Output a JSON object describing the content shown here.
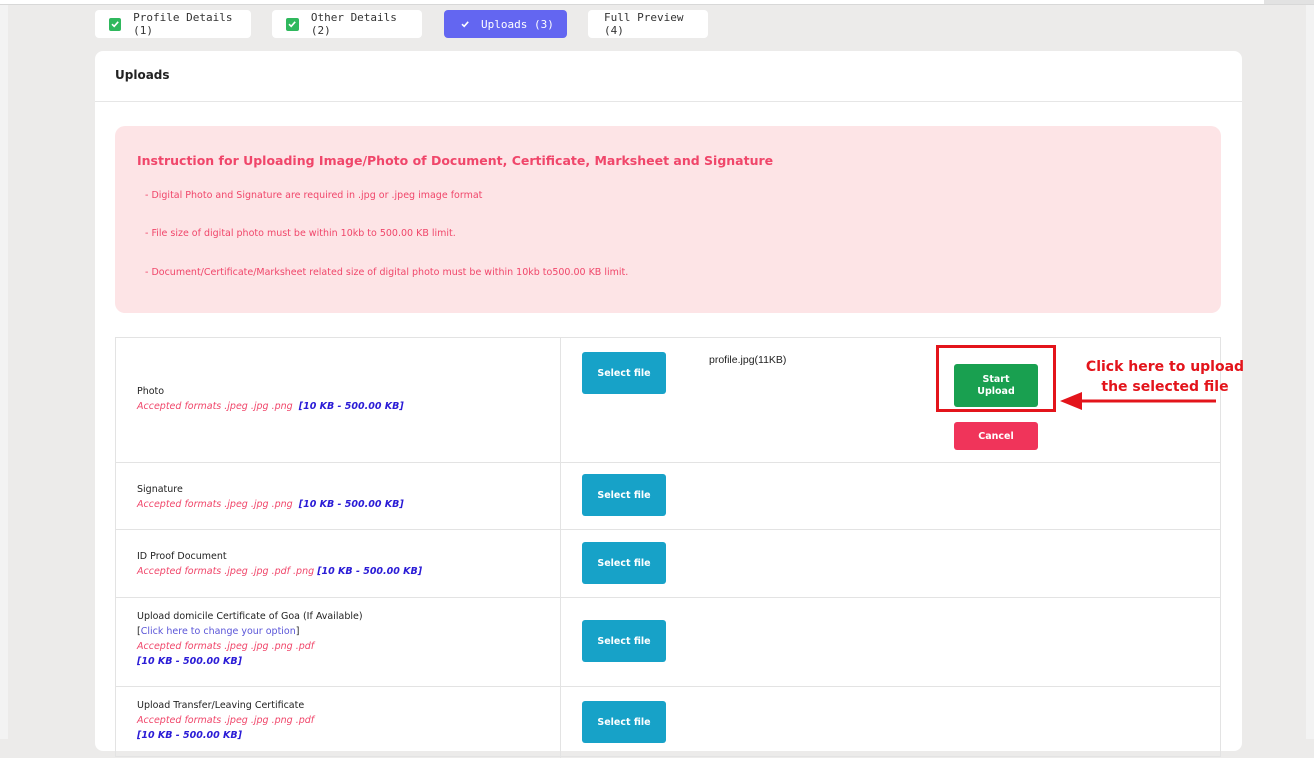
{
  "tabs": [
    {
      "label": "Profile Details (1)",
      "done": true,
      "active": false
    },
    {
      "label": "Other Details (2)",
      "done": true,
      "active": false
    },
    {
      "label": "Uploads (3)",
      "done": true,
      "active": true
    },
    {
      "label": "Full Preview (4)",
      "done": false,
      "active": false
    }
  ],
  "card": {
    "title": "Uploads"
  },
  "instructions": {
    "title": "Instruction for Uploading Image/Photo of Document, Certificate, Marksheet and Signature",
    "lines": [
      "- Digital Photo and Signature are required in .jpg or .jpeg image format",
      "- File size of digital photo must be within 10kb to 500.00 KB limit.",
      "- Document/Certificate/Marksheet related size of digital photo must be within 10kb to500.00 KB limit."
    ]
  },
  "select_label": "Select file",
  "rows": [
    {
      "label": "Photo",
      "formats": "Accepted formats .jpeg .jpg .png",
      "size": "[10 KB - 500.00 KB]",
      "selected_file": "profile.jpg(11KB)",
      "start_label": "Start Upload",
      "cancel_label": "Cancel"
    },
    {
      "label": "Signature",
      "formats": "Accepted formats .jpeg .jpg .png",
      "size": "[10 KB - 500.00 KB]"
    },
    {
      "label": "ID Proof Document",
      "formats": "Accepted formats .jpeg .jpg .pdf .png",
      "size": "[10 KB - 500.00 KB]"
    },
    {
      "label": "Upload domicile Certificate of Goa (If Available)",
      "link_open": "[",
      "link_text": "Click here to change your option",
      "link_close": "]",
      "formats": "Accepted formats .jpeg .jpg .png .pdf",
      "size": "[10 KB - 500.00 KB]"
    },
    {
      "label": "Upload Transfer/Leaving Certificate",
      "formats": "Accepted formats .jpeg .jpg .png .pdf",
      "size": "[10 KB - 500.00 KB]"
    }
  ],
  "annotation": {
    "line1": "Click here to upload",
    "line2": "the selected file"
  },
  "colors": {
    "accent": "#6366f1",
    "check": "#2fb85d",
    "select": "#17a2c8",
    "start": "#19a050",
    "cancel": "#f0345a",
    "annotation": "#e3141b"
  }
}
